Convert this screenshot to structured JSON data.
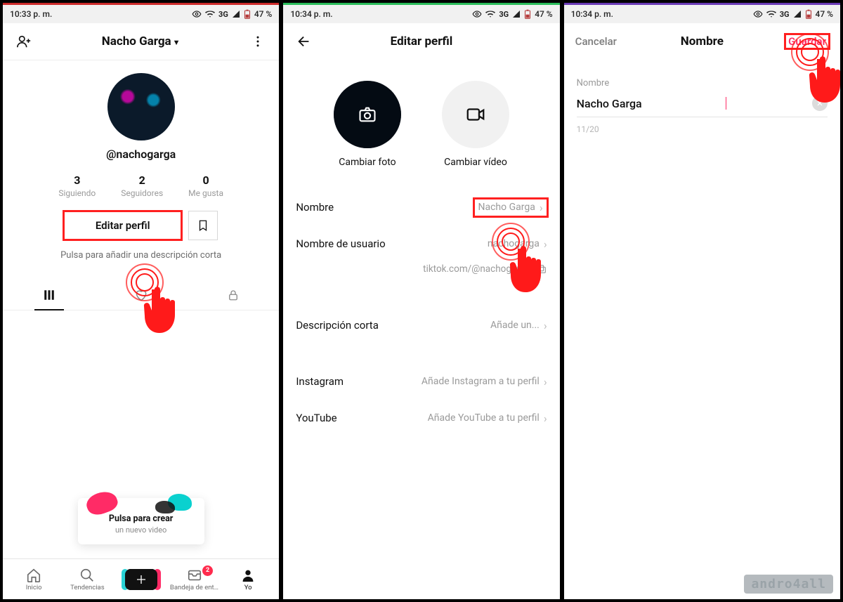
{
  "statusbar": {
    "time1": "10:33 p. m.",
    "time2": "10:34 p. m.",
    "time3": "10:34 p. m.",
    "network": "3G",
    "battery": "47 %"
  },
  "screen1": {
    "header_name": "Nacho Garga",
    "username": "@nachogarga",
    "stats": {
      "following_num": "3",
      "following_lbl": "Siguiendo",
      "followers_num": "2",
      "followers_lbl": "Seguidores",
      "likes_num": "0",
      "likes_lbl": "Me gusta"
    },
    "edit_button": "Editar perfil",
    "bio_hint": "Pulsa para añadir una descripción corta",
    "create_hint_title": "Pulsa para crear",
    "create_hint_sub": "un nuevo video",
    "nav": {
      "home": "Inicio",
      "trends": "Tendencias",
      "inbox": "Bandeja de entrada",
      "inbox_badge": "2",
      "me": "Yo"
    }
  },
  "screen2": {
    "title": "Editar perfil",
    "change_photo": "Cambiar foto",
    "change_video": "Cambiar vídeo",
    "rows": {
      "name_lbl": "Nombre",
      "name_val": "Nacho Garga",
      "user_lbl": "Nombre de usuario",
      "user_val": "nachogarga",
      "profile_link": "tiktok.com/@nachogarga",
      "bio_lbl": "Descripción corta",
      "bio_val": "Añade un...",
      "ig_lbl": "Instagram",
      "ig_val": "Añade Instagram a tu perfil",
      "yt_lbl": "YouTube",
      "yt_val": "Añade YouTube a tu perfil"
    }
  },
  "screen3": {
    "cancel": "Cancelar",
    "title": "Nombre",
    "save": "Guardar",
    "field_label": "Nombre",
    "input_value": "Nacho Garga",
    "counter": "11/20"
  },
  "watermark": "andro4all"
}
